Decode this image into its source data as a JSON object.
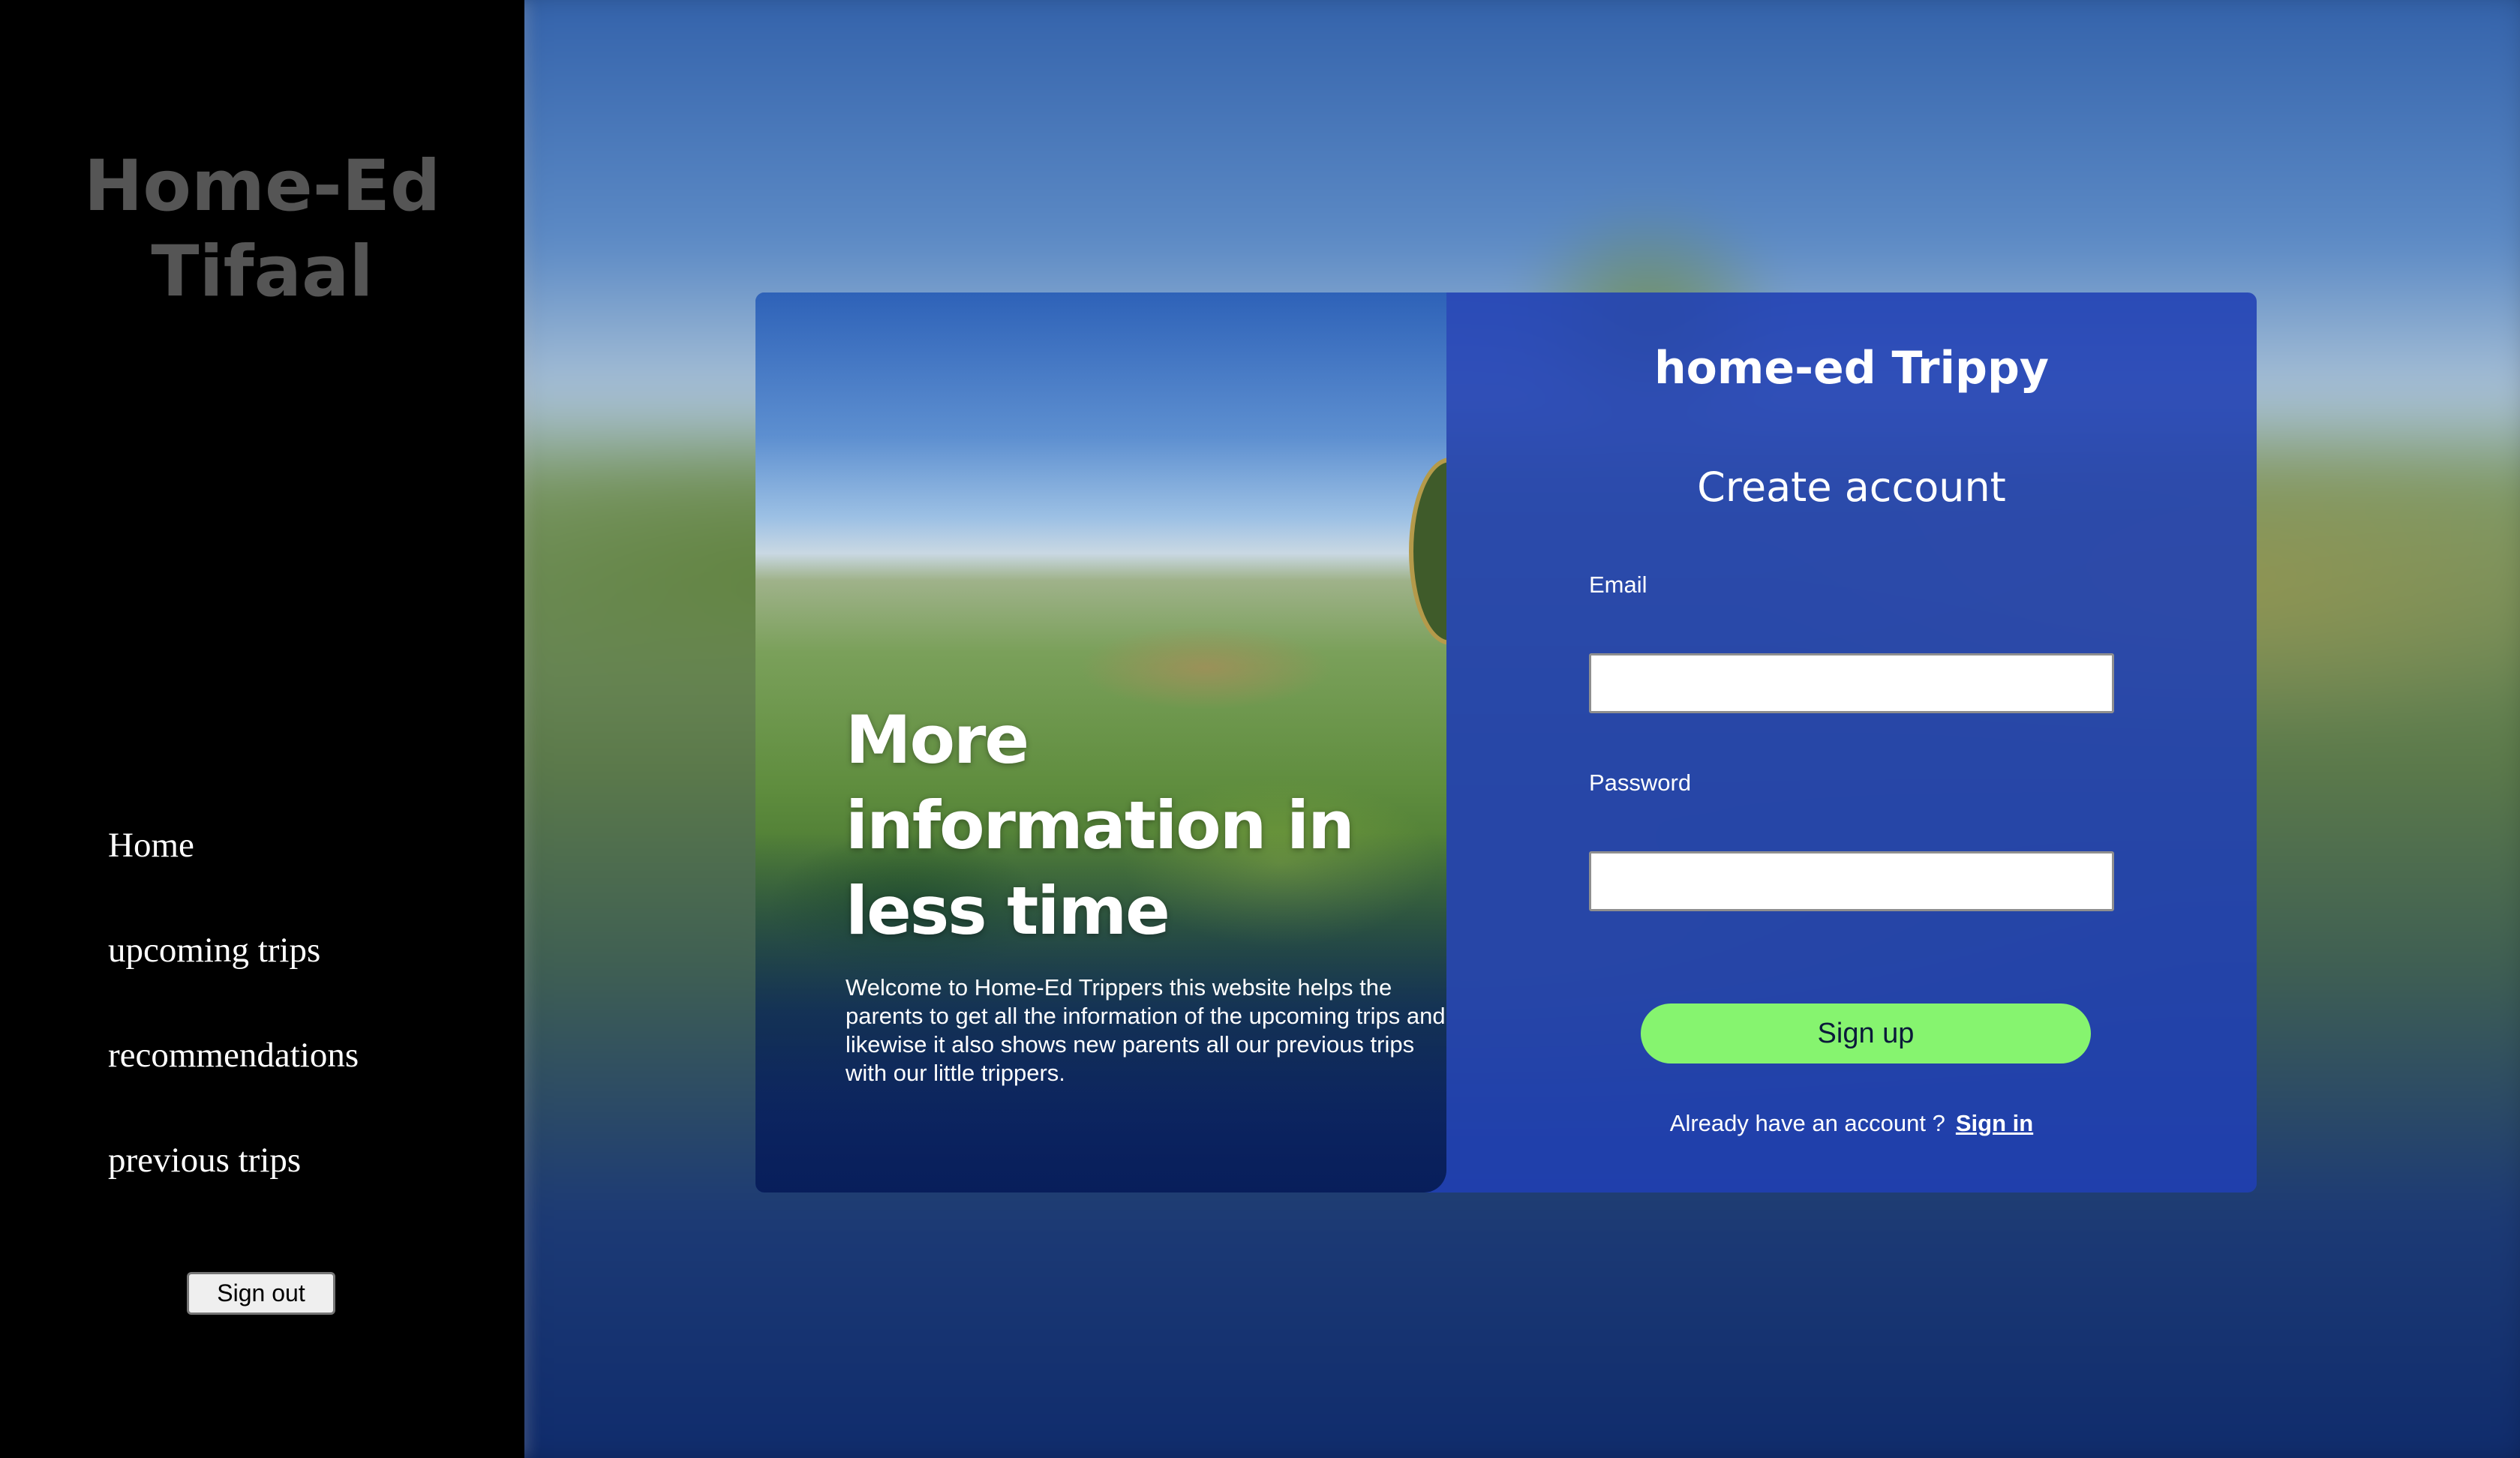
{
  "sidebar": {
    "brand_line1": "Home-Ed",
    "brand_line2": "Tifaal",
    "nav": [
      {
        "label": "Home"
      },
      {
        "label": "upcoming trips"
      },
      {
        "label": "recommendations"
      },
      {
        "label": "previous trips"
      }
    ],
    "signout_label": "Sign out"
  },
  "hero": {
    "headline": "More information in less time",
    "welcome": "Welcome to Home-Ed Trippers this website helps the parents to get all the information of the upcoming trips and likewise it also shows new parents all our previous trips with our little trippers."
  },
  "form": {
    "title": "home-ed Trippy",
    "subtitle": "Create account",
    "email_label": "Email",
    "email_value": "",
    "password_label": "Password",
    "password_value": "",
    "signup_label": "Sign up",
    "already_text": "Already have an account ?",
    "signin_link": "Sign in"
  },
  "colors": {
    "sidebar_bg": "#000000",
    "brand_text": "#555555",
    "card_bg": "#2040b4",
    "signup_button": "#86f46f"
  }
}
